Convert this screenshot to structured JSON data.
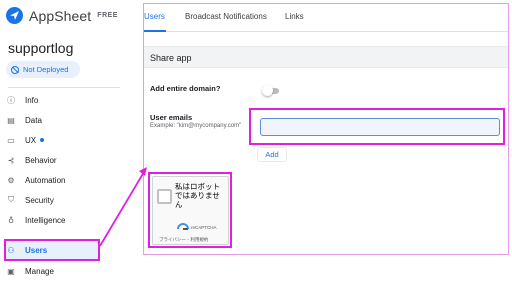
{
  "brand": {
    "name": "AppSheet",
    "tier": "FREE"
  },
  "app": {
    "name": "supportlog"
  },
  "deploy_status": {
    "label": "Not Deployed"
  },
  "nav": {
    "items": [
      {
        "label": "Info",
        "icon": "info-icon"
      },
      {
        "label": "Data",
        "icon": "data-icon"
      },
      {
        "label": "UX",
        "icon": "ux-icon"
      },
      {
        "label": "Behavior",
        "icon": "behavior-icon"
      },
      {
        "label": "Automation",
        "icon": "automation-icon"
      },
      {
        "label": "Security",
        "icon": "shield-icon"
      },
      {
        "label": "Intelligence",
        "icon": "lightbulb-icon"
      },
      {
        "label": "Users",
        "icon": "users-icon"
      },
      {
        "label": "Manage",
        "icon": "manage-icon"
      }
    ],
    "active": "Users"
  },
  "tabs": [
    {
      "label": "Users"
    },
    {
      "label": "Broadcast Notifications"
    },
    {
      "label": "Links"
    }
  ],
  "share": {
    "header": "Share app",
    "domain_label": "Add entire domain?",
    "emails_label": "User emails",
    "emails_hint": "Example: \"kim@mycompany.com\"",
    "email_value": "",
    "add_label": "Add"
  },
  "captcha": {
    "text": "私はロボットではありません",
    "brand": "reCAPTCHA",
    "links": "プライバシー - 利用規約"
  },
  "colors": {
    "accent": "#1a73e8",
    "annotation": "#e020e0"
  }
}
